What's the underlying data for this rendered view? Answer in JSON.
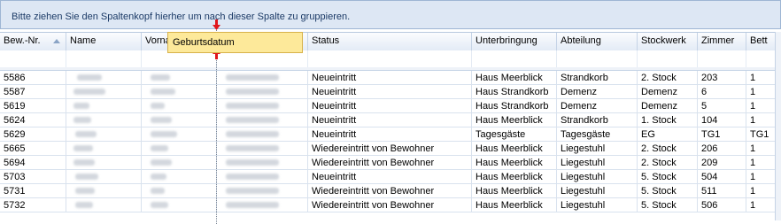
{
  "group_panel": {
    "hint": "Bitte ziehen Sie den Spaltenkopf hierher um nach dieser Spalte zu gruppieren."
  },
  "columns": [
    {
      "key": "bew_nr",
      "label": "Bew.-Nr."
    },
    {
      "key": "name",
      "label": "Name"
    },
    {
      "key": "vorname",
      "label": "Vorna"
    },
    {
      "key": "geburtsdatum",
      "label": ""
    },
    {
      "key": "status",
      "label": "Status"
    },
    {
      "key": "unterbringung",
      "label": "Unterbringung"
    },
    {
      "key": "abteilung",
      "label": "Abteilung"
    },
    {
      "key": "stockwerk",
      "label": "Stockwerk"
    },
    {
      "key": "zimmer",
      "label": "Zimmer"
    },
    {
      "key": "bett",
      "label": "Bett"
    }
  ],
  "sort": {
    "column": "bew_nr",
    "direction": "ascending"
  },
  "drag_tooltip": {
    "label": "Geburtsdatum"
  },
  "rows": [
    {
      "bew_nr": "5586",
      "status": "Neueintritt",
      "unterbringung": "Haus Meerblick",
      "abteilung": "Strandkorb",
      "stockwerk": "2. Stock",
      "zimmer": "203",
      "bett": "1"
    },
    {
      "bew_nr": "5587",
      "status": "Neueintritt",
      "unterbringung": "Haus Strandkorb",
      "abteilung": "Demenz",
      "stockwerk": "Demenz",
      "zimmer": "6",
      "bett": "1"
    },
    {
      "bew_nr": "5619",
      "status": "Neueintritt",
      "unterbringung": "Haus Strandkorb",
      "abteilung": "Demenz",
      "stockwerk": "Demenz",
      "zimmer": "5",
      "bett": "1"
    },
    {
      "bew_nr": "5624",
      "status": "Neueintritt",
      "unterbringung": "Haus Meerblick",
      "abteilung": "Strandkorb",
      "stockwerk": "1. Stock",
      "zimmer": "104",
      "bett": "1"
    },
    {
      "bew_nr": "5629",
      "status": "Neueintritt",
      "unterbringung": "Tagesgäste",
      "abteilung": "Tagesgäste",
      "stockwerk": "EG",
      "zimmer": "TG1",
      "bett": "TG1"
    },
    {
      "bew_nr": "5665",
      "status": "Wiedereintritt von Bewohner",
      "unterbringung": "Haus Meerblick",
      "abteilung": "Liegestuhl",
      "stockwerk": "2. Stock",
      "zimmer": "206",
      "bett": "1"
    },
    {
      "bew_nr": "5694",
      "status": "Wiedereintritt von Bewohner",
      "unterbringung": "Haus Meerblick",
      "abteilung": "Liegestuhl",
      "stockwerk": "2. Stock",
      "zimmer": "209",
      "bett": "1"
    },
    {
      "bew_nr": "5703",
      "status": "Neueintritt",
      "unterbringung": "Haus Meerblick",
      "abteilung": "Liegestuhl",
      "stockwerk": "5. Stock",
      "zimmer": "504",
      "bett": "1"
    },
    {
      "bew_nr": "5731",
      "status": "Wiedereintritt von Bewohner",
      "unterbringung": "Haus Meerblick",
      "abteilung": "Liegestuhl",
      "stockwerk": "5. Stock",
      "zimmer": "511",
      "bett": "1"
    },
    {
      "bew_nr": "5732",
      "status": "Wiedereintritt von Bewohner",
      "unterbringung": "Haus Meerblick",
      "abteilung": "Liegestuhl",
      "stockwerk": "5. Stock",
      "zimmer": "506",
      "bett": "1"
    }
  ],
  "colors": {
    "panel": "#dde7f4",
    "header": "#e3ebf6",
    "tooltip": "#fde99a",
    "marker": "#e0151b"
  }
}
